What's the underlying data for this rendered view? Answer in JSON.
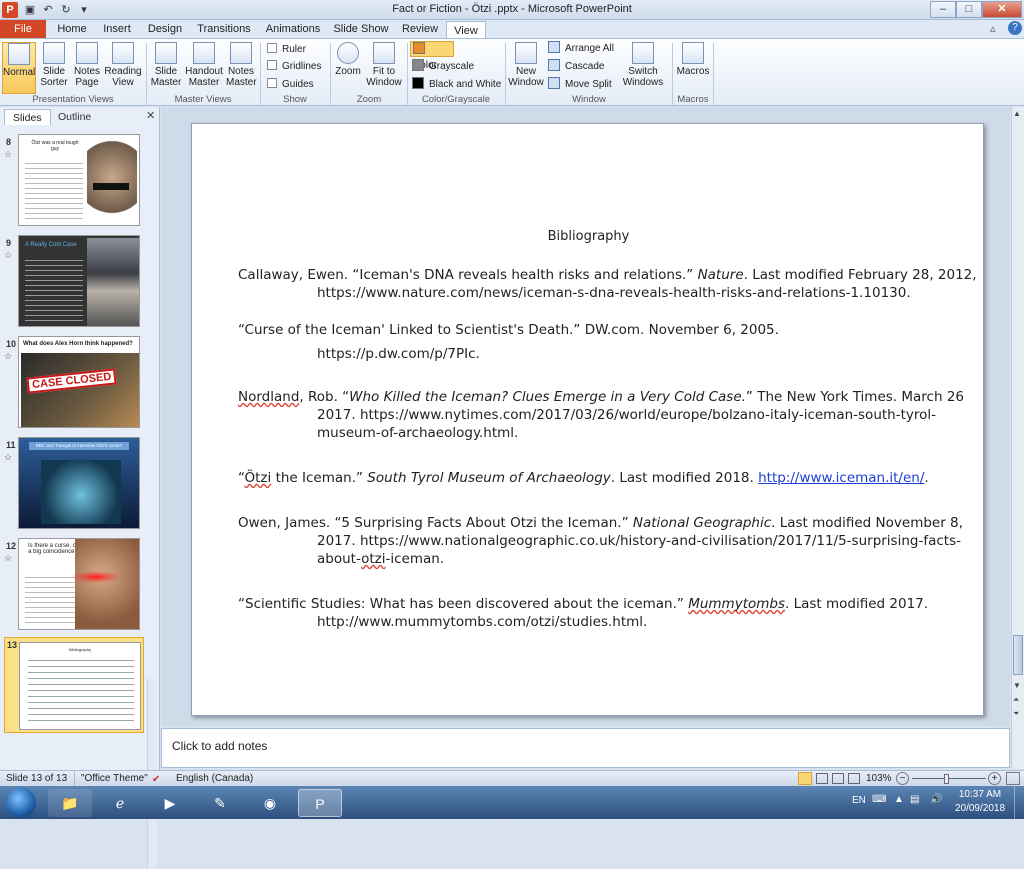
{
  "window": {
    "title": "Fact or Fiction - Ötzi .pptx - Microsoft PowerPoint",
    "min": "–",
    "max": "□",
    "close": "✕"
  },
  "tabs": [
    {
      "label": "File"
    },
    {
      "label": "Home"
    },
    {
      "label": "Insert"
    },
    {
      "label": "Design"
    },
    {
      "label": "Transitions"
    },
    {
      "label": "Animations"
    },
    {
      "label": "Slide Show"
    },
    {
      "label": "Review"
    },
    {
      "label": "View"
    }
  ],
  "ribbon": {
    "presentation_views": {
      "group": "Presentation Views",
      "normal": "Normal",
      "slide_sorter": "Slide Sorter",
      "notes_page": "Notes Page",
      "reading_view": "Reading View"
    },
    "master_views": {
      "group": "Master Views",
      "slide_master": "Slide Master",
      "handout_master": "Handout Master",
      "notes_master": "Notes Master"
    },
    "show": {
      "group": "Show",
      "ruler": "Ruler",
      "gridlines": "Gridlines",
      "guides": "Guides"
    },
    "zoom": {
      "group": "Zoom",
      "zoom": "Zoom",
      "fit": "Fit to Window"
    },
    "color": {
      "group": "Color/Grayscale",
      "color": "Color",
      "grayscale": "Grayscale",
      "bw": "Black and White"
    },
    "window": {
      "group": "Window",
      "new_window": "New Window",
      "arrange_all": "Arrange All",
      "cascade": "Cascade",
      "move_split": "Move Split",
      "switch": "Switch Windows"
    },
    "macros": {
      "group": "Macros",
      "macros": "Macros"
    }
  },
  "panel_tabs": {
    "slides": "Slides",
    "outline": "Outline"
  },
  "thumbnails": [
    {
      "num": "8",
      "title": "Ötzi was a real tough guy"
    },
    {
      "num": "9",
      "title": "A Really Cold Case"
    },
    {
      "num": "10",
      "title": "What does Alex Horn think happened?",
      "stamp": "CASE CLOSED"
    },
    {
      "num": "11",
      "title": "BBC and Tranquil to interview Ötzi's curse?"
    },
    {
      "num": "12",
      "title": "Is there a curse, or a big coincidence?"
    },
    {
      "num": "13",
      "title": "Bibliography"
    }
  ],
  "slide": {
    "heading": "Bibliography",
    "entries": [
      {
        "p1": "Callaway, Ewen. “Iceman's DNA reveals health  risks and relations.” ",
        "i1": "Nature",
        "p2": ". Last modified  February 28, 2012,",
        "line2": "https://www.nature.com/news/iceman-s-dna-reveals-health-risks-and-relations-1.10130."
      },
      {
        "p1": "“Curse of the Iceman' Linked to Scientist's Death.” DW.com. November 6, 2005.",
        "line2": "https://p.dw.com/p/7PIc."
      },
      {
        "author": "Nordland",
        "p1": ", Rob.  “",
        "i1": "Who Killed the Iceman? Clues Emerge in a Very Cold Case.",
        "p2": "” The New York Times. March 26",
        "line2": "2017. https://www.nytimes.com/2017/03/26/world/europe/bolzano-italy-iceman-south-tyrol-",
        "line3": "museum-of-archaeology.html."
      },
      {
        "q": "“",
        "sq": "Ötzi",
        "p1": " the  Iceman.” ",
        "i1": "South Tyrol Museum of Archaeology",
        "p2": ". Last modified  2018. ",
        "link": "http://www.iceman.it/en/",
        "p3": "."
      },
      {
        "p1": "Owen, James. “5 Surprising Facts About Otzi the  Iceman.” ",
        "i1": "National Geographic",
        "p2": ". Last modified November 8,",
        "line2": "2017. https://www.nationalgeographic.co.uk/history-and-civilisation/2017/11/5-surprising-facts-",
        "line3a": "about-",
        "line3sq": "otzi",
        "line3b": "-iceman."
      },
      {
        "p1": "“Scientific Studies: What has been discovered about the iceman.” ",
        "i1sq": "Mummytombs",
        "p2": ".  Last modified  2017.",
        "line2": "http://www.mummytombs.com/otzi/studies.html."
      }
    ]
  },
  "notes_placeholder": "Click to add notes",
  "status": {
    "slide": "Slide 13 of 13",
    "theme": "\"Office Theme\"",
    "lang": "English (Canada)",
    "zoom": "103%",
    "minus": "−",
    "plus": "+"
  },
  "taskbar": {
    "lang": "EN",
    "time": "10:37 AM",
    "date": "20/09/2018"
  }
}
